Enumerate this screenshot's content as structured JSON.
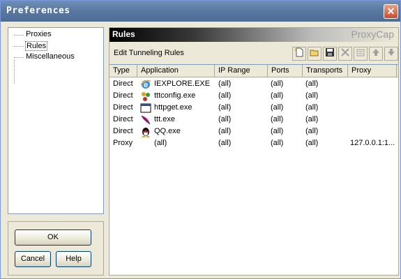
{
  "window": {
    "title": "Preferences",
    "close_glyph": "✕"
  },
  "tree": {
    "items": [
      "Proxies",
      "Rules",
      "Miscellaneous"
    ]
  },
  "buttons": {
    "ok": "OK",
    "cancel": "Cancel",
    "help": "Help"
  },
  "panel": {
    "title": "Rules",
    "brand": "ProxyCap",
    "toolbar_label": "Edit Tunneling Rules",
    "toolbar_icons": [
      "new-icon",
      "open-folder-icon",
      "save-icon",
      "delete-icon",
      "properties-icon",
      "move-up-icon",
      "move-down-icon"
    ]
  },
  "table": {
    "columns": [
      "Type",
      "Application",
      "IP Range",
      "Ports",
      "Transports",
      "Proxy"
    ],
    "rows": [
      {
        "type": "Direct",
        "app": "IEXPLORE.EXE",
        "icon": "ie-icon",
        "ip": "(all)",
        "ports": "(all)",
        "transports": "(all)",
        "proxy": ""
      },
      {
        "type": "Direct",
        "app": "tttconfig.exe",
        "icon": "config-icon",
        "ip": "(all)",
        "ports": "(all)",
        "transports": "(all)",
        "proxy": ""
      },
      {
        "type": "Direct",
        "app": "httpget.exe",
        "icon": "window-icon",
        "ip": "(all)",
        "ports": "(all)",
        "transports": "(all)",
        "proxy": ""
      },
      {
        "type": "Direct",
        "app": "ttt.exe",
        "icon": "feather-icon",
        "ip": "(all)",
        "ports": "(all)",
        "transports": "(all)",
        "proxy": ""
      },
      {
        "type": "Direct",
        "app": "QQ.exe",
        "icon": "qq-penguin-icon",
        "ip": "(all)",
        "ports": "(all)",
        "transports": "(all)",
        "proxy": ""
      },
      {
        "type": "Proxy",
        "app": "(all)",
        "icon": "",
        "ip": "(all)",
        "ports": "(all)",
        "transports": "(all)",
        "proxy": "127.0.0.1:1..."
      }
    ]
  },
  "colors": {
    "title_bar": "#5a7aa3",
    "list_border": "#7f9db9",
    "dialog_bg": "#ece9d8"
  }
}
